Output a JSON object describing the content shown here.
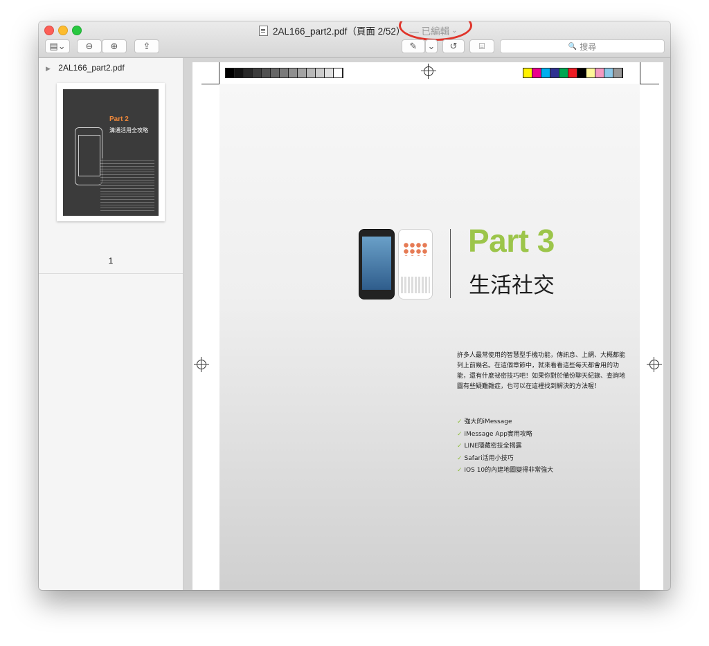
{
  "window": {
    "title": "2AL166_part2.pdf（頁面 2/52）",
    "edited_label": "— 已編輯",
    "edited_chevron": "⌄"
  },
  "toolbar": {
    "sidebar_toggle": "▤⌄",
    "zoom_out": "⊖",
    "zoom_in": "⊕",
    "share": "⇪",
    "markup": "✎",
    "markup_menu": "⌄",
    "rotate": "↺",
    "toolbox": "⌸",
    "search_placeholder": "搜尋",
    "search_icon": "🔍"
  },
  "sidebar": {
    "file_name": "2AL166_part2.pdf",
    "thumbnail": {
      "part": "Part 2",
      "subtitle": "溝通活用全攻略",
      "page_label": "1"
    }
  },
  "page": {
    "part_title": "Part 3",
    "section_title": "生活社交",
    "paragraph": "許多人最常使用的智慧型手機功能，傳訊息、上網、大概都能列上前幾名。在這個章節中，就來看看這些每天都會用的功能，還有什麼祕密技巧吧！如果你對於備份聊天紀錄、查詢地圖有些疑難雜症，也可以在這裡找到解決的方法喔！",
    "checklist": [
      "強大的iMessage",
      "iMessage App實用攻略",
      "LINE隱藏密技全揭露",
      "Safari活用小技巧",
      "iOS 10的內建地圖變得非常強大"
    ],
    "check_glyph": "✓",
    "grey_swatches": [
      "#000000",
      "#141414",
      "#292929",
      "#3d3d3d",
      "#525252",
      "#666666",
      "#7a7a7a",
      "#8f8f8f",
      "#a3a3a3",
      "#b8b8b8",
      "#cccccc",
      "#e0e0e0",
      "#ffffff"
    ],
    "color_swatches": [
      "#fff200",
      "#ec008c",
      "#00aeef",
      "#2e3192",
      "#00a651",
      "#ed1c24",
      "#000000",
      "#fff799",
      "#f49ac1",
      "#8dc8e8",
      "#999999"
    ]
  },
  "colors": {
    "accent_green": "#9cc54a",
    "annotation_red": "#e0342a"
  }
}
